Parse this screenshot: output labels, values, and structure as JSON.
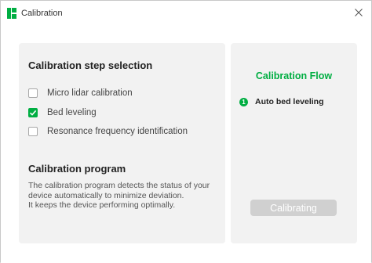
{
  "window": {
    "title": "Calibration"
  },
  "icons": {
    "app": "app-logo-icon",
    "close": "close-icon",
    "check": "check-icon"
  },
  "colors": {
    "accent": "#00ae42",
    "panel_bg": "#f2f2f2",
    "disabled_button": "#d0d0d0"
  },
  "steps_panel": {
    "title": "Calibration step selection",
    "options": [
      {
        "label": "Micro lidar calibration",
        "checked": false
      },
      {
        "label": "Bed leveling",
        "checked": true
      },
      {
        "label": "Resonance frequency identification",
        "checked": false
      }
    ]
  },
  "program": {
    "title": "Calibration program",
    "description_lines": [
      "The calibration program detects the status of your device automatically to minimize deviation.",
      "It keeps the device performing optimally."
    ]
  },
  "flow_panel": {
    "title": "Calibration Flow",
    "steps": [
      {
        "number": "1",
        "label": "Auto bed leveling"
      }
    ],
    "button_label": "Calibrating",
    "button_enabled": false
  }
}
